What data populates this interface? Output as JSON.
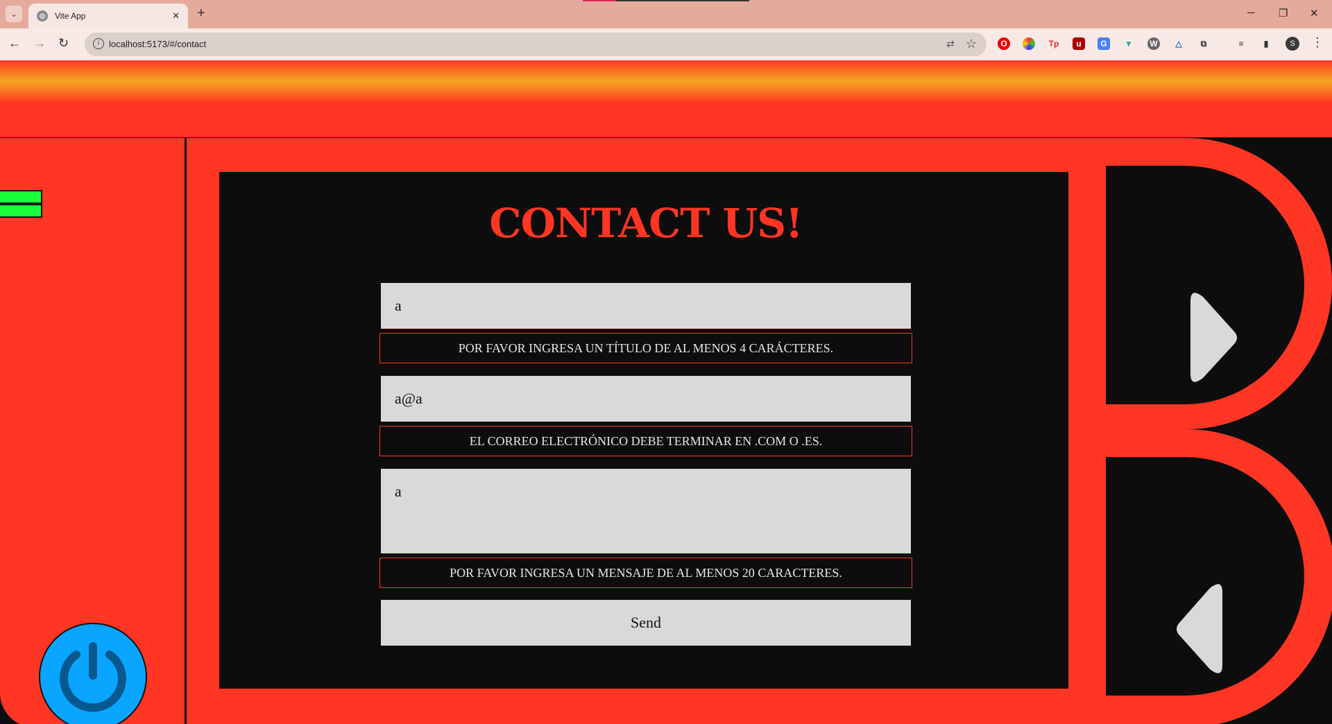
{
  "browser": {
    "tab_title": "Vite App",
    "url": "localhost:5173/#/contact",
    "profile_initial": "S"
  },
  "contact": {
    "title": "CONTACT US!",
    "name_value": "a",
    "email_value": "a@a",
    "message_value": "a",
    "errors": {
      "title": "POR FAVOR INGRESA UN TÍTULO DE AL MENOS 4 CARÁCTERES.",
      "email": "EL CORREO ELECTRÓNICO DEBE TERMINAR EN .COM O .ES.",
      "message": "POR FAVOR INGRESA UN MENSAJE DE AL MENOS 20 CARACTERES."
    },
    "send_label": "Send"
  },
  "colors": {
    "frame_red": "#ff3623",
    "band_yellow": "#f5a623",
    "screen_black": "#0d0d0d",
    "field_gray": "#d9d9d9",
    "power_blue": "#0aa5ff",
    "menu_green": "#17ff3a"
  },
  "icons": {
    "power": "power-icon",
    "menu": "hamburger-icon",
    "next": "arrow-right-icon",
    "prev": "arrow-left-icon"
  }
}
